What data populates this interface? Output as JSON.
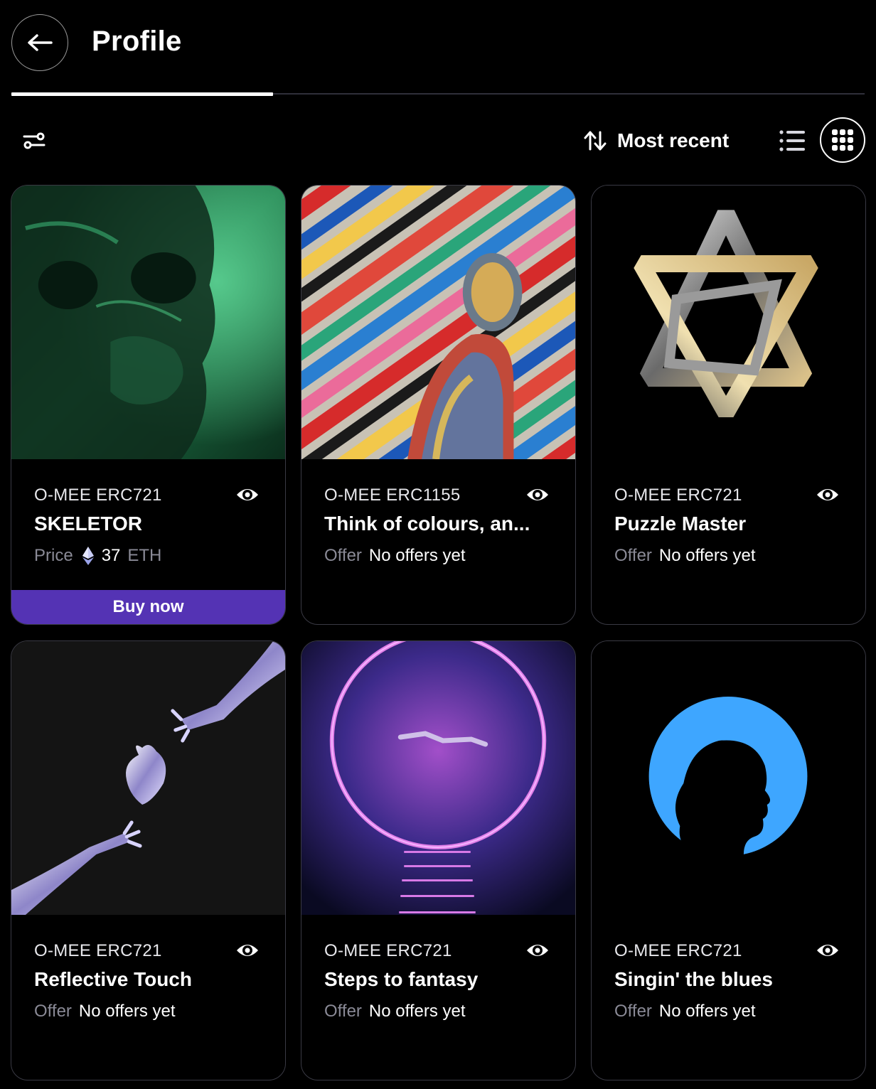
{
  "header": {
    "title": "Profile"
  },
  "toolbar": {
    "sort_label": "Most recent"
  },
  "colors": {
    "accent": "#5433b4",
    "muted_text": "#8a8a96",
    "card_border": "#3a3a44"
  },
  "cards": [
    {
      "collection": "O-MEE ERC721",
      "title": "SKELETOR",
      "meta_label": "Price",
      "meta_value": "37",
      "meta_unit": "ETH",
      "currency_icon": "ethereum-icon",
      "button_label": "Buy now"
    },
    {
      "collection": "O-MEE ERC1155",
      "title": "Think of colours, an...",
      "meta_label": "Offer",
      "meta_value": "No offers yet"
    },
    {
      "collection": "O-MEE ERC721",
      "title": "Puzzle Master",
      "meta_label": "Offer",
      "meta_value": "No offers yet"
    },
    {
      "collection": "O-MEE ERC721",
      "title": "Reflective Touch",
      "meta_label": "Offer",
      "meta_value": "No offers yet"
    },
    {
      "collection": "O-MEE ERC721",
      "title": "Steps to fantasy",
      "meta_label": "Offer",
      "meta_value": "No offers yet"
    },
    {
      "collection": "O-MEE ERC721",
      "title": "Singin' the blues",
      "meta_label": "Offer",
      "meta_value": "No offers yet"
    }
  ]
}
